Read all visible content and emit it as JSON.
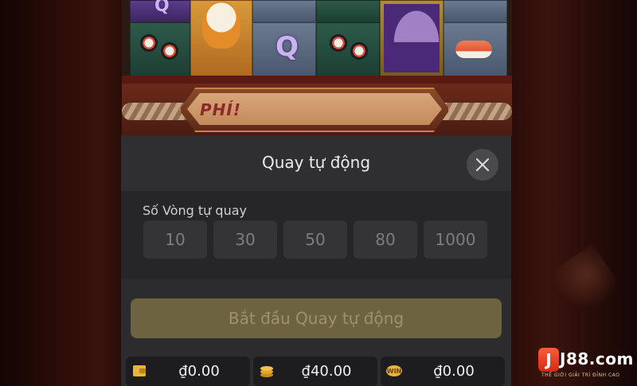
{
  "board": {
    "symbol_q": "Q",
    "banner_text": "PHÍ!"
  },
  "modal": {
    "title": "Quay tự động",
    "close_icon": "close-icon",
    "rounds_label": "Số Vòng tự quay",
    "rounds_options": [
      "10",
      "30",
      "50",
      "80",
      "1000"
    ],
    "start_button": "Bắt đầu Quay tự động"
  },
  "stats": [
    {
      "icon": "wallet-icon",
      "value": "₫0.00"
    },
    {
      "icon": "coins-icon",
      "value": "₫40.00"
    },
    {
      "icon": "win-icon",
      "value": "₫0.00"
    }
  ],
  "logo": {
    "badge": "J",
    "name": "J88.com",
    "tagline": "THẾ GIỚI GIẢI TRÍ ĐỈNH CAO"
  },
  "colors": {
    "modal_bg": "#2c2c2e",
    "start_button_bg": "#6e6340",
    "chip_bg": "#343437"
  }
}
